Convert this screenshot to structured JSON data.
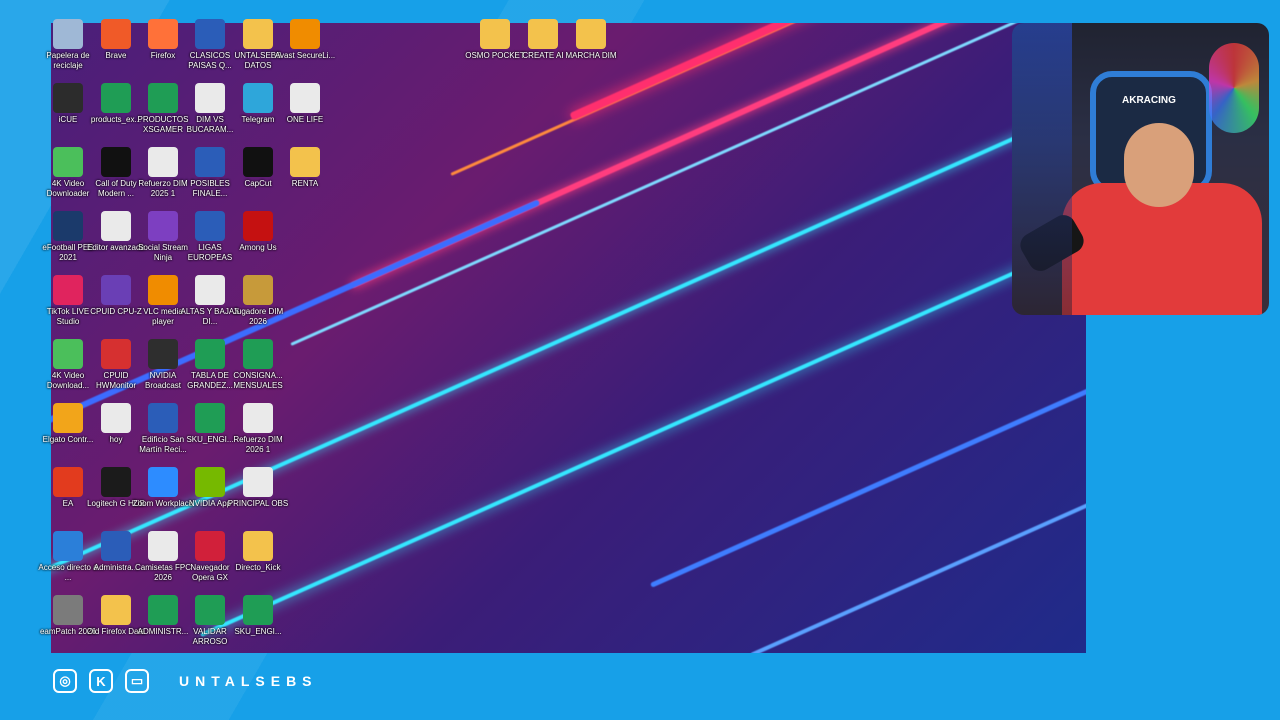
{
  "desktop": {
    "icons_col1": [
      {
        "label": "Papelera de reciclaje",
        "icon": "recycle-bin-icon",
        "color": "#9fb8d6"
      },
      {
        "label": "iCUE",
        "icon": "icue-icon",
        "color": "#2c2c2c"
      },
      {
        "label": "4K Video Downloader",
        "icon": "download-cloud-icon",
        "color": "#4bbf5b"
      },
      {
        "label": "eFootball PES 2021",
        "icon": "pes-icon",
        "color": "#1b3a6b"
      },
      {
        "label": "TikTok LIVE Studio",
        "icon": "tiktok-icon",
        "color": "#e0245e"
      },
      {
        "label": "4K Video Download...",
        "icon": "download-cloud-icon",
        "color": "#4bbf5b"
      },
      {
        "label": "Elgato Contr...",
        "icon": "elgato-icon",
        "color": "#f2a51a"
      },
      {
        "label": "EA",
        "icon": "ea-icon",
        "color": "#e23b1e"
      },
      {
        "label": "Acceso directo a ...",
        "icon": "onedrive-icon",
        "color": "#2b7fd9"
      },
      {
        "label": "eamPatch 2026",
        "icon": "patch-icon",
        "color": "#7b7b7b"
      }
    ],
    "icons_col2": [
      {
        "label": "Brave",
        "icon": "brave-icon",
        "color": "#f05a28"
      },
      {
        "label": "products_ex...",
        "icon": "excel-icon",
        "color": "#1f9d55"
      },
      {
        "label": "Call of Duty Modern ...",
        "icon": "cod-icon",
        "color": "#111111"
      },
      {
        "label": "Editor avanzado",
        "icon": "file-icon",
        "color": "#eaeaea"
      },
      {
        "label": "CPUID CPU-Z",
        "icon": "cpuz-icon",
        "color": "#6a3fb5"
      },
      {
        "label": "CPUID HWMonitor",
        "icon": "hwmonitor-icon",
        "color": "#d63030"
      },
      {
        "label": "hoy",
        "icon": "file-icon",
        "color": "#eaeaea"
      },
      {
        "label": "Logitech G HUB",
        "icon": "logitech-icon",
        "color": "#1b1b1b"
      },
      {
        "label": "Administra...",
        "icon": "word-icon",
        "color": "#2b5db8"
      },
      {
        "label": "Old Firefox Data",
        "icon": "folder-icon",
        "color": "#f3c24c"
      }
    ],
    "icons_col3": [
      {
        "label": "Firefox",
        "icon": "firefox-icon",
        "color": "#ff7139"
      },
      {
        "label": "PRODUCTOS XSGAMER",
        "icon": "excel-icon",
        "color": "#1f9d55"
      },
      {
        "label": "Refuerzo DIM 2025 1",
        "icon": "file-icon",
        "color": "#eaeaea"
      },
      {
        "label": "Social Stream Ninja",
        "icon": "ninja-icon",
        "color": "#7d3fc1"
      },
      {
        "label": "VLC media player",
        "icon": "vlc-icon",
        "color": "#f08c00"
      },
      {
        "label": "NVIDIA Broadcast",
        "icon": "nvidia-icon",
        "color": "#2e2e2e"
      },
      {
        "label": "Edificio San Martín Reci...",
        "icon": "word-icon",
        "color": "#2b5db8"
      },
      {
        "label": "Zoom Workplace",
        "icon": "zoom-icon",
        "color": "#2d8cff"
      },
      {
        "label": "Camisetas FPC 2026",
        "icon": "file-icon",
        "color": "#eaeaea"
      },
      {
        "label": "ADMINISTR...",
        "icon": "excel-icon",
        "color": "#1f9d55"
      }
    ],
    "icons_col4": [
      {
        "label": "CLASICOS PAISAS Q...",
        "icon": "word-icon",
        "color": "#2b5db8"
      },
      {
        "label": "DIM VS BUCARAM...",
        "icon": "file-icon",
        "color": "#eaeaea"
      },
      {
        "label": "POSIBLES FINALE...",
        "icon": "word-icon",
        "color": "#2b5db8"
      },
      {
        "label": "LIGAS EUROPEAS",
        "icon": "word-icon",
        "color": "#2b5db8"
      },
      {
        "label": "ALTAS Y BAJAS DI...",
        "icon": "file-icon",
        "color": "#eaeaea"
      },
      {
        "label": "TABLA DE GRANDEZ...",
        "icon": "excel-icon",
        "color": "#1f9d55"
      },
      {
        "label": "SKU_ENGI...",
        "icon": "excel-icon",
        "color": "#1f9d55"
      },
      {
        "label": "NVIDIA App",
        "icon": "nvidia-app-icon",
        "color": "#76b900"
      },
      {
        "label": "Navegador Opera GX",
        "icon": "opera-icon",
        "color": "#d1203a"
      },
      {
        "label": "VALIDAR ARROSO",
        "icon": "excel-icon",
        "color": "#1f9d55"
      }
    ],
    "icons_col5": [
      {
        "label": "UNTALSEBS DATOS",
        "icon": "folder-icon",
        "color": "#f3c24c"
      },
      {
        "label": "Telegram",
        "icon": "telegram-icon",
        "color": "#2ea6da"
      },
      {
        "label": "CapCut",
        "icon": "capcut-icon",
        "color": "#111111"
      },
      {
        "label": "Among Us",
        "icon": "among-us-icon",
        "color": "#c51111"
      },
      {
        "label": "Jugadore DIM 2026",
        "icon": "archive-icon",
        "color": "#c79a3a"
      },
      {
        "label": "CONSIGNA... MENSUALES",
        "icon": "excel-icon",
        "color": "#1f9d55"
      },
      {
        "label": "Refuerzo DIM 2026 1",
        "icon": "file-icon",
        "color": "#eaeaea"
      },
      {
        "label": "PRINCIPAL OBS",
        "icon": "json-icon",
        "color": "#eaeaea"
      },
      {
        "label": "Directo_Kick",
        "icon": "folder-zip-icon",
        "color": "#f3c24c"
      },
      {
        "label": "SKU_ENGI...",
        "icon": "excel-icon",
        "color": "#1f9d55"
      }
    ],
    "icons_col6": [
      {
        "label": "Avast SecureLi...",
        "icon": "lock-icon",
        "color": "#f08c00"
      },
      {
        "label": "ONE LIFE",
        "icon": "chrome-doc-icon",
        "color": "#eaeaea"
      },
      {
        "label": "RENTA",
        "icon": "folder-icon",
        "color": "#f3c24c"
      }
    ],
    "icons_top": [
      {
        "label": "OSMO POCKET",
        "icon": "folder-icon",
        "color": "#f3c24c"
      },
      {
        "label": "CREATE AI",
        "icon": "folder-icon",
        "color": "#f3c24c"
      },
      {
        "label": "MARCHA DIM",
        "icon": "folder-icon",
        "color": "#f3c24c"
      }
    ]
  },
  "webcam": {
    "chair_brand": "AKRACING"
  },
  "footer": {
    "handle": "UNTALSEBS",
    "socials": [
      {
        "name": "instagram-icon",
        "glyph": "◎"
      },
      {
        "name": "kick-icon",
        "glyph": "K"
      },
      {
        "name": "twitch-icon",
        "glyph": "▭"
      }
    ]
  }
}
